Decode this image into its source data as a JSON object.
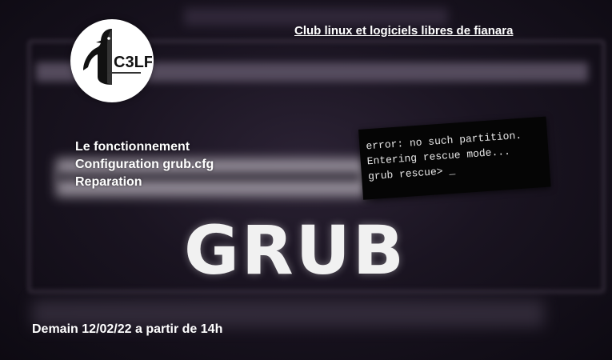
{
  "club_title": "Club linux et logiciels libres de fianara",
  "logo": {
    "text": "C3LF",
    "icon": "penguin-icon"
  },
  "agenda": [
    "Le fonctionnement",
    "Configuration grub.cfg",
    "Reparation"
  ],
  "terminal": [
    "error: no such partition.",
    "Entering rescue mode...",
    "grub rescue> _"
  ],
  "headline": "GRUB",
  "event_date": "Demain 12/02/22 a partir de 14h",
  "colors": {
    "text": "#ffffff",
    "background": "#1a1421",
    "terminal_bg": "#050505"
  }
}
